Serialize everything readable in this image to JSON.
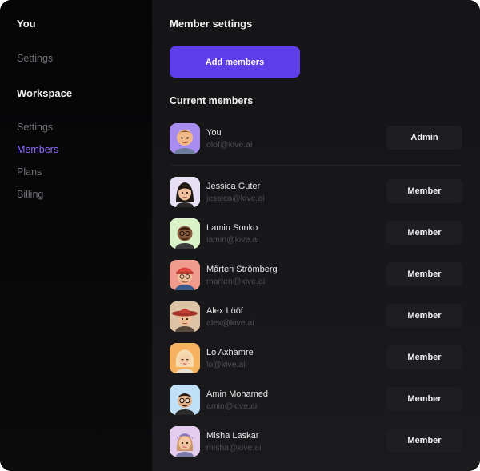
{
  "sidebar": {
    "you_heading": "You",
    "you_settings": "Settings",
    "workspace_heading": "Workspace",
    "workspace_links": [
      "Settings",
      "Members",
      "Plans",
      "Billing"
    ],
    "active_link": "Members"
  },
  "main": {
    "title": "Member settings",
    "add_button": "Add members",
    "section_title": "Current members"
  },
  "members": [
    {
      "name": "You",
      "email": "olof@kive.ai",
      "role": "Admin",
      "avatar": "memoji-you-icon",
      "avatar_bg": "#a98cf0"
    },
    {
      "name": "Jessica Guter",
      "email": "jessica@kive.ai",
      "role": "Member",
      "avatar": "memoji-jessica-icon",
      "avatar_bg": "#e7dff3"
    },
    {
      "name": "Lamin Sonko",
      "email": "lamin@kive.ai",
      "role": "Member",
      "avatar": "memoji-lamin-icon",
      "avatar_bg": "#d9f2c8"
    },
    {
      "name": "Mårten Strömberg",
      "email": "marten@kive.ai",
      "role": "Member",
      "avatar": "memoji-marten-icon",
      "avatar_bg": "#f19a8e"
    },
    {
      "name": "Alex Lööf",
      "email": "alex@kive.ai",
      "role": "Member",
      "avatar": "memoji-alex-icon",
      "avatar_bg": "#dcc3a6"
    },
    {
      "name": "Lo Axhamre",
      "email": "lo@kive.ai",
      "role": "Member",
      "avatar": "memoji-lo-icon",
      "avatar_bg": "#f6b25f"
    },
    {
      "name": "Amin Mohamed",
      "email": "amin@kive.ai",
      "role": "Member",
      "avatar": "memoji-amin-icon",
      "avatar_bg": "#bfe0f7"
    },
    {
      "name": "Misha Laskar",
      "email": "misha@kive.ai",
      "role": "Member",
      "avatar": "memoji-misha-icon",
      "avatar_bg": "#e4ccef"
    }
  ],
  "colors": {
    "accent": "#5d3ee8",
    "active_link": "#8b6cff",
    "sidebar_bg": "#070708",
    "main_bg": "#17171a"
  }
}
